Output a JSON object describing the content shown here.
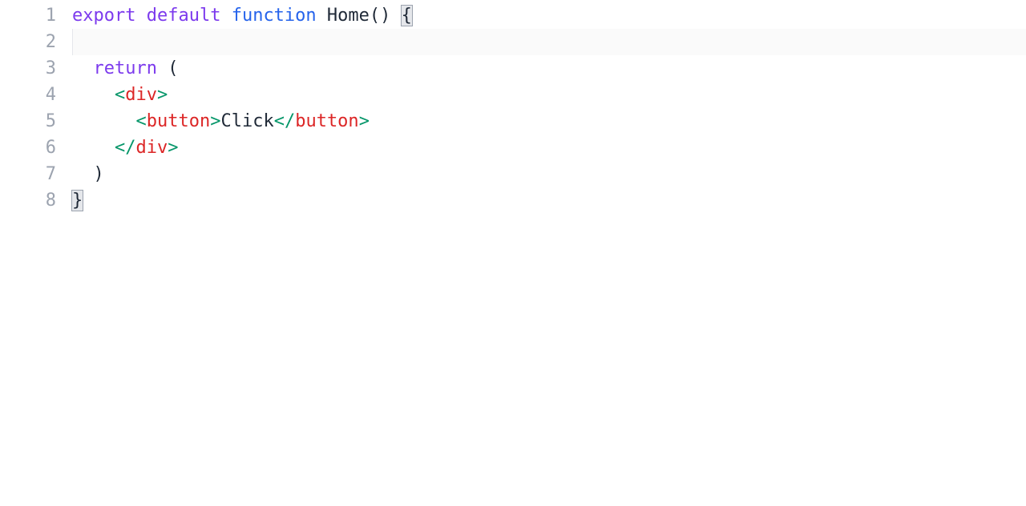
{
  "lineNumbers": [
    "1",
    "2",
    "3",
    "4",
    "5",
    "6",
    "7",
    "8"
  ],
  "code": {
    "line1": {
      "export": "export",
      "default": "default",
      "function": "function",
      "fnName": "Home",
      "parens": "()",
      "brace": "{"
    },
    "line2": "",
    "line3": {
      "return": "return",
      "paren": "("
    },
    "line4": {
      "open": "<",
      "tag": "div",
      "close": ">"
    },
    "line5": {
      "open1": "<",
      "tag1": "button",
      "close1": ">",
      "text": "Click",
      "open2": "</",
      "tag2": "button",
      "close2": ">"
    },
    "line6": {
      "open": "</",
      "tag": "div",
      "close": ">"
    },
    "line7": {
      "paren": ")"
    },
    "line8": {
      "brace": "}"
    }
  }
}
